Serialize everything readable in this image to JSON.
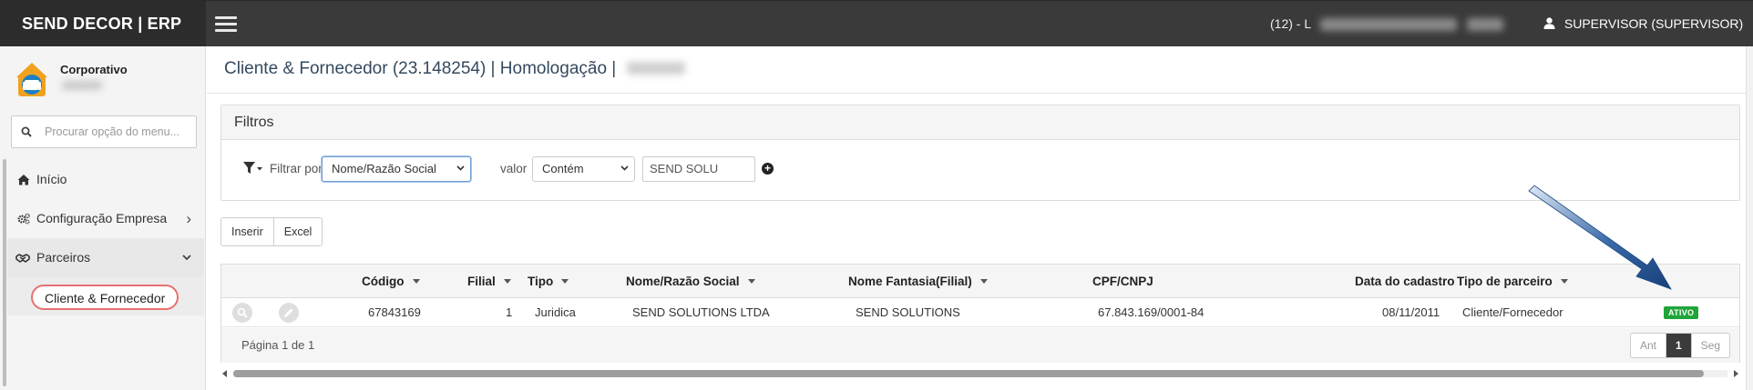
{
  "app": {
    "brand": "SEND DECOR | ERP"
  },
  "topbar": {
    "company_code": "(12) - L",
    "user": "SUPERVISOR (SUPERVISOR)",
    "icons": [
      "menu-icon",
      "user-icon",
      "caret-down-icon"
    ]
  },
  "sidebar": {
    "org_name": "Corporativo",
    "search_placeholder": "Procurar opção do menu...",
    "items": [
      {
        "label": "Início",
        "icon": "home-icon"
      },
      {
        "label": "Configuração Empresa",
        "icon": "cogs-icon",
        "chevron": "›"
      },
      {
        "label": "Parceiros",
        "icon": "handshake-icon",
        "chevron": "⌄"
      }
    ],
    "subitem": "Cliente & Fornecedor"
  },
  "page": {
    "title": "Cliente & Fornecedor (23.148254) | Homologação |"
  },
  "filters": {
    "title": "Filtros",
    "filter_by_label": "Filtrar por",
    "field_selected": "Nome/Razão Social",
    "value_label": "valor",
    "operator_selected": "Contém",
    "value": "SEND SOLU"
  },
  "actions": {
    "insert": "Inserir",
    "excel": "Excel"
  },
  "table": {
    "columns": [
      "Código",
      "Filial",
      "Tipo",
      "Nome/Razão Social",
      "Nome Fantasia(Filial)",
      "CPF/CNPJ",
      "Data do cadastro",
      "Tipo de parceiro"
    ],
    "rows": [
      {
        "codigo": "67843169",
        "filial": "1",
        "tipo": "Juridica",
        "razao_social": "SEND SOLUTIONS LTDA",
        "fantasia": "SEND SOLUTIONS",
        "cnpj": "67.843.169/0001-84",
        "data_cadastro": "08/11/2011",
        "tipo_parceiro": "Cliente/Fornecedor",
        "status": "ATIVO"
      }
    ],
    "page_info": "Página 1 de 1",
    "pager": {
      "prev": "Ant",
      "current": "1",
      "next": "Seg"
    }
  },
  "colors": {
    "topbar": "#3a3a3a",
    "brand_bg": "#2c2c2c",
    "status_active": "#1fa53a",
    "highlight": "#e87070",
    "arrow": "#1c4a86"
  }
}
